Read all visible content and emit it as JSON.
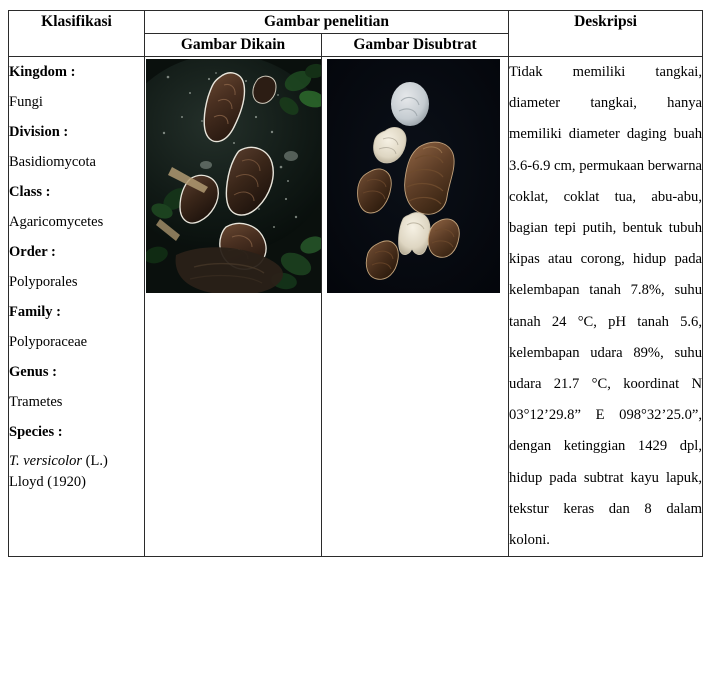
{
  "table": {
    "headers": {
      "klasifikasi": "Klasifikasi",
      "gambar_penelitian": "Gambar penelitian",
      "gambar_dikain": "Gambar Dikain",
      "gambar_disubtrat": "Gambar Disubtrat",
      "deskripsi": "Deskripsi"
    },
    "classification": [
      {
        "rank": "Kingdom :",
        "value": "Fungi"
      },
      {
        "rank": "Division :",
        "value": "Basidiomycota"
      },
      {
        "rank": "Class :",
        "value": "Agaricomycetes"
      },
      {
        "rank": "Order :",
        "value": "Polyporales"
      },
      {
        "rank": "Family :",
        "value": "Polyporaceae"
      },
      {
        "rank": "Genus :",
        "value": "Trametes"
      },
      {
        "rank": "Species :",
        "value": "T. versicolor (L.) Lloyd  (1920)"
      }
    ],
    "species_parts": {
      "italic": "T. versicolor",
      "rest": " (L.) Lloyd  (1920)"
    },
    "images": {
      "dikain": {
        "caption": "Gambar Dikain",
        "alt": "Foto jamur Trametes versicolor di lapangan pada batang kayu lapuk dengan garis tepi putih penanda",
        "background": "#0d1410"
      },
      "disubtrat": {
        "caption": "Gambar Disubtrat",
        "alt": "Foto spesimen jamur Trametes versicolor di atas latar hitam",
        "background": "#05070c"
      }
    },
    "description": "Tidak memiliki tangkai, diameter tangkai, hanya memiliki diameter daging buah 3.6-6.9 cm, permukaan berwarna coklat, coklat tua, abu-abu, bagian tepi putih, bentuk tubuh kipas atau corong, hidup pada kelembapan tanah 7.8%, suhu tanah 24 °C, pH tanah 5.6, kelembapan udara 89%, suhu udara 21.7 °C, koordinat N 03°12’29.8” E 098°32’25.0”, dengan ketinggian 1429 dpl, hidup pada subtrat kayu lapuk, tekstur keras dan 8 dalam koloni.",
    "description_values": {
      "diameter_daging_buah_cm": "3.6-6.9",
      "kelembapan_tanah": "7.8%",
      "suhu_tanah": "24 °C",
      "ph_tanah": "5.6",
      "kelembapan_udara": "89%",
      "suhu_udara": "21.7 °C",
      "koordinat_n": "03°12’29.8”",
      "koordinat_e": "098°32’25.0”",
      "ketinggian_dpl": "1429",
      "jumlah_koloni": "8"
    }
  },
  "colors": {
    "border": "#2b2b2b",
    "text": "#000000",
    "page_background": "#ffffff"
  }
}
